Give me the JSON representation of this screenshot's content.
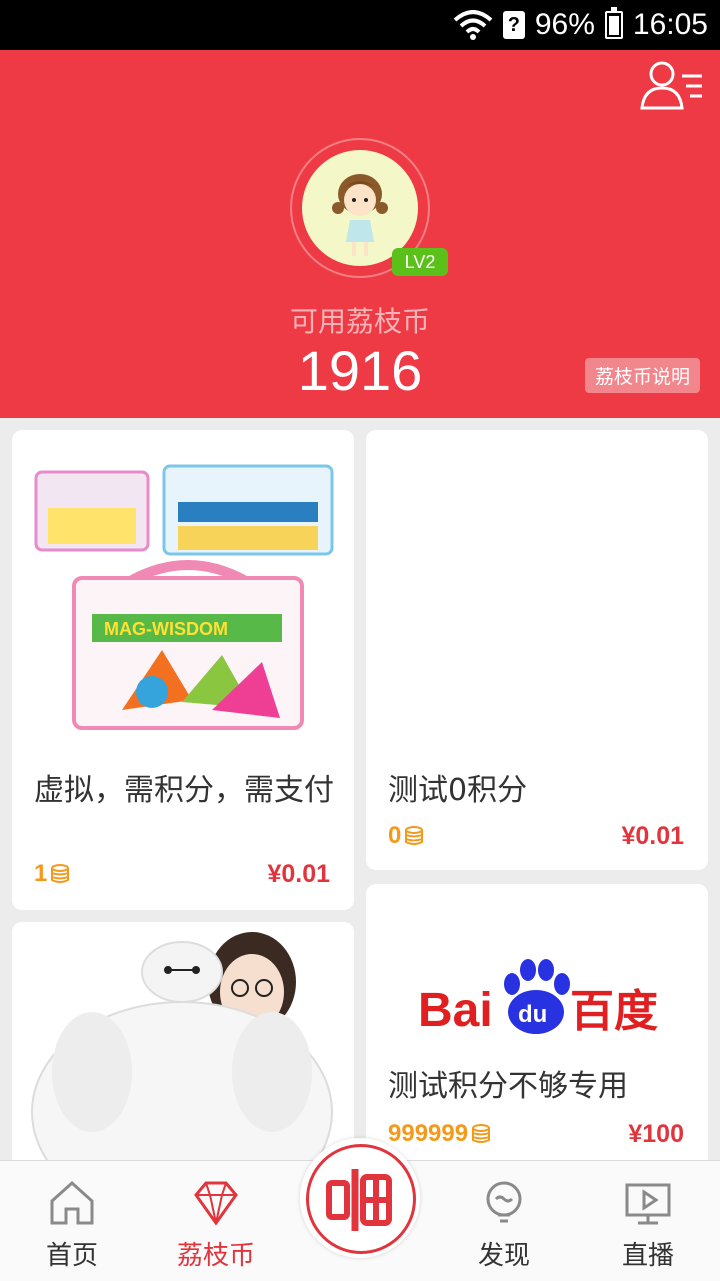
{
  "status_bar": {
    "battery": "96%",
    "time": "16:05"
  },
  "header": {
    "level": "LV2",
    "coin_label": "可用荔枝币",
    "coin_amount": "1916",
    "explain_button": "荔枝币说明"
  },
  "products": [
    {
      "title": "虚拟，需积分，需支付",
      "coins": "1",
      "price": "¥0.01"
    },
    {
      "title": "测试0积分",
      "coins": "0",
      "price": "¥0.01"
    },
    {
      "title": "",
      "coins": "",
      "price": ""
    },
    {
      "title": "测试积分不够专用",
      "coins": "999999",
      "price": "¥100"
    }
  ],
  "product_images": {
    "box": "mag-wisdom-toy-box",
    "plush": "plush-baymax-toy",
    "logo": "baidu-logo"
  },
  "baidu_logo": {
    "text_left": "Bai",
    "text_du": "du",
    "text_cn": "百度"
  },
  "bottom_nav": [
    {
      "label": "首页",
      "icon": "home-icon"
    },
    {
      "label": "荔枝币",
      "icon": "diamond-icon",
      "active": true
    },
    {
      "label": "",
      "icon": "pa-icon"
    },
    {
      "label": "发现",
      "icon": "bulb-icon"
    },
    {
      "label": "直播",
      "icon": "tv-icon"
    }
  ],
  "colors": {
    "brand_red": "#ee3a44",
    "accent_red": "#e2343d",
    "coin_orange": "#f39a1c",
    "level_green": "#5cc01b"
  }
}
